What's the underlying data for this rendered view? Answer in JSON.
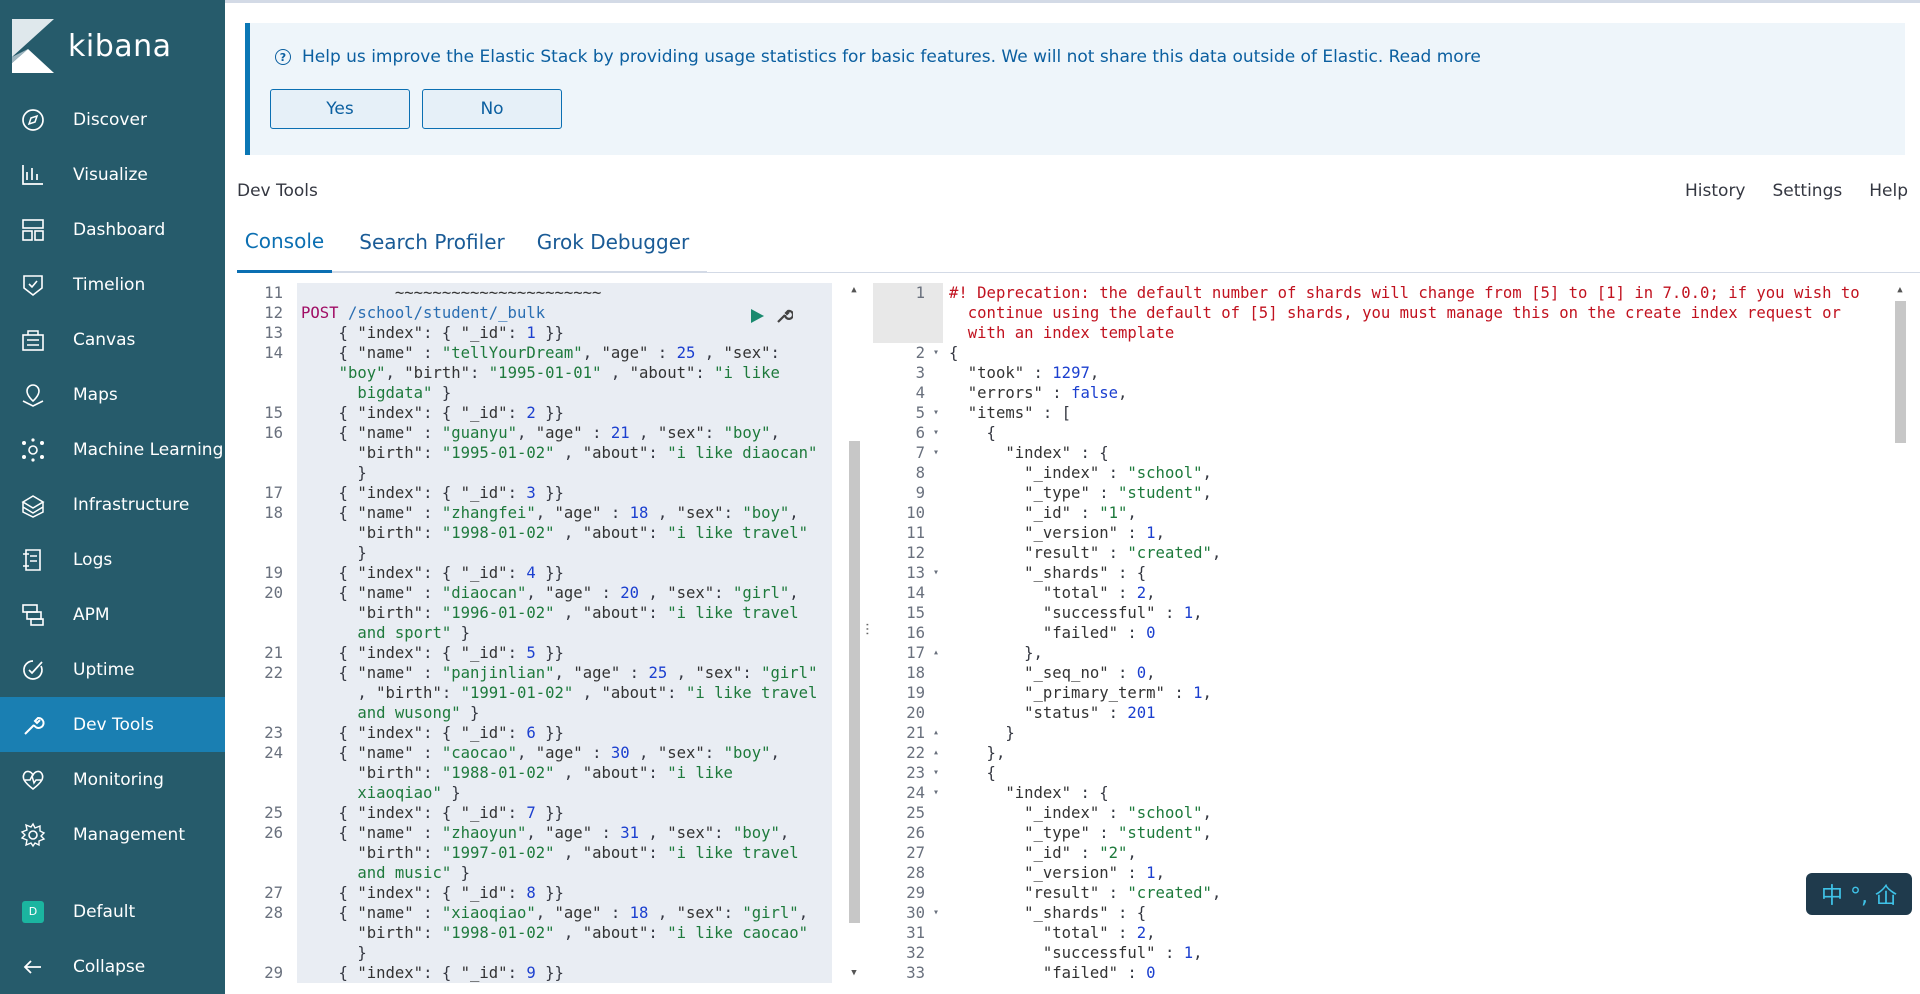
{
  "sidebar": {
    "logo_text": "kibana",
    "items": [
      {
        "label": "Discover",
        "icon": "compass-icon"
      },
      {
        "label": "Visualize",
        "icon": "visualize-icon"
      },
      {
        "label": "Dashboard",
        "icon": "dashboard-icon"
      },
      {
        "label": "Timelion",
        "icon": "timelion-icon"
      },
      {
        "label": "Canvas",
        "icon": "canvas-icon"
      },
      {
        "label": "Maps",
        "icon": "maps-icon"
      },
      {
        "label": "Machine Learning",
        "icon": "machine-learning-icon"
      },
      {
        "label": "Infrastructure",
        "icon": "infrastructure-icon"
      },
      {
        "label": "Logs",
        "icon": "logs-icon"
      },
      {
        "label": "APM",
        "icon": "apm-icon"
      },
      {
        "label": "Uptime",
        "icon": "uptime-icon"
      },
      {
        "label": "Dev Tools",
        "icon": "wrench-icon"
      },
      {
        "label": "Monitoring",
        "icon": "monitoring-icon"
      },
      {
        "label": "Management",
        "icon": "gear-icon"
      }
    ],
    "active": "Dev Tools",
    "space_badge": "D",
    "space_label": "Default",
    "collapse_label": "Collapse"
  },
  "callout": {
    "text": "Help us improve the Elastic Stack by providing usage statistics for basic features. We will not share this data outside of Elastic. Read more",
    "yes_label": "Yes",
    "no_label": "No"
  },
  "header": {
    "title": "Dev Tools",
    "links": [
      "History",
      "Settings",
      "Help"
    ]
  },
  "tabs": [
    "Console",
    "Search Profiler",
    "Grok Debugger"
  ],
  "request_editor": {
    "lines": [
      {
        "n": "11",
        "html": "<span class='plain'>          ~~~~~~~~~~~~~~~~~~~~~~</span>"
      },
      {
        "n": "12",
        "html": "<span class='k'>POST</span> <span class='url'>/school/student/_bulk</span>"
      },
      {
        "n": "13",
        "html": "    { <span class='key'>\"index\"</span>: { <span class='key'>\"_id\"</span>: <span class='num'>1</span> }}"
      },
      {
        "n": "14",
        "html": "    { <span class='key'>\"name\"</span> : <span class='str'>\"tellYourDream\"</span>, <span class='key'>\"age\"</span> : <span class='num'>25</span> , <span class='key'>\"sex\"</span>:"
      },
      {
        "n": "",
        "html": "    <span class='str'>\"boy\"</span>, <span class='key'>\"birth\"</span>: <span class='str'>\"1995-01-01\"</span> , <span class='key'>\"about\"</span>: <span class='str'>\"i like</span>"
      },
      {
        "n": "",
        "html": "      <span class='str'>bigdata\"</span> }"
      },
      {
        "n": "15",
        "html": "    { <span class='key'>\"index\"</span>: { <span class='key'>\"_id\"</span>: <span class='num'>2</span> }}"
      },
      {
        "n": "16",
        "html": "    { <span class='key'>\"name\"</span> : <span class='str'>\"guanyu\"</span>, <span class='key'>\"age\"</span> : <span class='num'>21</span> , <span class='key'>\"sex\"</span>: <span class='str'>\"boy\"</span>,"
      },
      {
        "n": "",
        "html": "      <span class='key'>\"birth\"</span>: <span class='str'>\"1995-01-02\"</span> , <span class='key'>\"about\"</span>: <span class='str'>\"i like diaocan\"</span>"
      },
      {
        "n": "",
        "html": "      }"
      },
      {
        "n": "17",
        "html": "    { <span class='key'>\"index\"</span>: { <span class='key'>\"_id\"</span>: <span class='num'>3</span> }}"
      },
      {
        "n": "18",
        "html": "    { <span class='key'>\"name\"</span> : <span class='str'>\"zhangfei\"</span>, <span class='key'>\"age\"</span> : <span class='num'>18</span> , <span class='key'>\"sex\"</span>: <span class='str'>\"boy\"</span>,"
      },
      {
        "n": "",
        "html": "      <span class='key'>\"birth\"</span>: <span class='str'>\"1998-01-02\"</span> , <span class='key'>\"about\"</span>: <span class='str'>\"i like travel\"</span>"
      },
      {
        "n": "",
        "html": "      }"
      },
      {
        "n": "19",
        "html": "    { <span class='key'>\"index\"</span>: { <span class='key'>\"_id\"</span>: <span class='num'>4</span> }}"
      },
      {
        "n": "20",
        "html": "    { <span class='key'>\"name\"</span> : <span class='str'>\"diaocan\"</span>, <span class='key'>\"age\"</span> : <span class='num'>20</span> , <span class='key'>\"sex\"</span>: <span class='str'>\"girl\"</span>,"
      },
      {
        "n": "",
        "html": "      <span class='key'>\"birth\"</span>: <span class='str'>\"1996-01-02\"</span> , <span class='key'>\"about\"</span>: <span class='str'>\"i like travel</span>"
      },
      {
        "n": "",
        "html": "      <span class='str'>and sport\"</span> }"
      },
      {
        "n": "21",
        "html": "    { <span class='key'>\"index\"</span>: { <span class='key'>\"_id\"</span>: <span class='num'>5</span> }}"
      },
      {
        "n": "22",
        "html": "    { <span class='key'>\"name\"</span> : <span class='str'>\"panjinlian\"</span>, <span class='key'>\"age\"</span> : <span class='num'>25</span> , <span class='key'>\"sex\"</span>: <span class='str'>\"girl\"</span>"
      },
      {
        "n": "",
        "html": "      , <span class='key'>\"birth\"</span>: <span class='str'>\"1991-01-02\"</span> , <span class='key'>\"about\"</span>: <span class='str'>\"i like travel</span>"
      },
      {
        "n": "",
        "html": "      <span class='str'>and wusong\"</span> }"
      },
      {
        "n": "23",
        "html": "    { <span class='key'>\"index\"</span>: { <span class='key'>\"_id\"</span>: <span class='num'>6</span> }}"
      },
      {
        "n": "24",
        "html": "    { <span class='key'>\"name\"</span> : <span class='str'>\"caocao\"</span>, <span class='key'>\"age\"</span> : <span class='num'>30</span> , <span class='key'>\"sex\"</span>: <span class='str'>\"boy\"</span>,"
      },
      {
        "n": "",
        "html": "      <span class='key'>\"birth\"</span>: <span class='str'>\"1988-01-02\"</span> , <span class='key'>\"about\"</span>: <span class='str'>\"i like</span>"
      },
      {
        "n": "",
        "html": "      <span class='str'>xiaoqiao\"</span> }"
      },
      {
        "n": "25",
        "html": "    { <span class='key'>\"index\"</span>: { <span class='key'>\"_id\"</span>: <span class='num'>7</span> }}"
      },
      {
        "n": "26",
        "html": "    { <span class='key'>\"name\"</span> : <span class='str'>\"zhaoyun\"</span>, <span class='key'>\"age\"</span> : <span class='num'>31</span> , <span class='key'>\"sex\"</span>: <span class='str'>\"boy\"</span>,"
      },
      {
        "n": "",
        "html": "      <span class='key'>\"birth\"</span>: <span class='str'>\"1997-01-02\"</span> , <span class='key'>\"about\"</span>: <span class='str'>\"i like travel</span>"
      },
      {
        "n": "",
        "html": "      <span class='str'>and music\"</span> }"
      },
      {
        "n": "27",
        "html": "    { <span class='key'>\"index\"</span>: { <span class='key'>\"_id\"</span>: <span class='num'>8</span> }}"
      },
      {
        "n": "28",
        "html": "    { <span class='key'>\"name\"</span> : <span class='str'>\"xiaoqiao\"</span>, <span class='key'>\"age\"</span> : <span class='num'>18</span> , <span class='key'>\"sex\"</span>: <span class='str'>\"girl\"</span>,"
      },
      {
        "n": "",
        "html": "      <span class='key'>\"birth\"</span>: <span class='str'>\"1998-01-02\"</span> , <span class='key'>\"about\"</span>: <span class='str'>\"i like caocao\"</span>"
      },
      {
        "n": "",
        "html": "      }"
      },
      {
        "n": "29",
        "html": "    { <span class='key'>\"index\"</span>: { <span class='key'>\"_id\"</span>: <span class='num'>9</span> }}"
      }
    ]
  },
  "response_editor": {
    "lines": [
      {
        "n": "1",
        "fold": "",
        "html": "<span class='warn'>#! Deprecation: the default number of shards will change from [5] to [1] in 7.0.0; if you wish to</span>"
      },
      {
        "n": "",
        "fold": "",
        "html": "<span class='warn'>  continue using the default of [5] shards, you must manage this on the create index request or</span>"
      },
      {
        "n": "",
        "fold": "",
        "html": "<span class='warn'>  with an index template</span>"
      },
      {
        "n": "2",
        "fold": "▾",
        "html": "{"
      },
      {
        "n": "3",
        "fold": "",
        "html": "  <span class='key'>\"took\"</span> : <span class='num'>1297</span>,"
      },
      {
        "n": "4",
        "fold": "",
        "html": "  <span class='key'>\"errors\"</span> : <span class='bool'>false</span>,"
      },
      {
        "n": "5",
        "fold": "▾",
        "html": "  <span class='key'>\"items\"</span> : ["
      },
      {
        "n": "6",
        "fold": "▾",
        "html": "    {"
      },
      {
        "n": "7",
        "fold": "▾",
        "html": "      <span class='key'>\"index\"</span> : {"
      },
      {
        "n": "8",
        "fold": "",
        "html": "        <span class='key'>\"_index\"</span> : <span class='str'>\"school\"</span>,"
      },
      {
        "n": "9",
        "fold": "",
        "html": "        <span class='key'>\"_type\"</span> : <span class='str'>\"student\"</span>,"
      },
      {
        "n": "10",
        "fold": "",
        "html": "        <span class='key'>\"_id\"</span> : <span class='str'>\"1\"</span>,"
      },
      {
        "n": "11",
        "fold": "",
        "html": "        <span class='key'>\"_version\"</span> : <span class='num'>1</span>,"
      },
      {
        "n": "12",
        "fold": "",
        "html": "        <span class='key'>\"result\"</span> : <span class='str'>\"created\"</span>,"
      },
      {
        "n": "13",
        "fold": "▾",
        "html": "        <span class='key'>\"_shards\"</span> : {"
      },
      {
        "n": "14",
        "fold": "",
        "html": "          <span class='key'>\"total\"</span> : <span class='num'>2</span>,"
      },
      {
        "n": "15",
        "fold": "",
        "html": "          <span class='key'>\"successful\"</span> : <span class='num'>1</span>,"
      },
      {
        "n": "16",
        "fold": "",
        "html": "          <span class='key'>\"failed\"</span> : <span class='num'>0</span>"
      },
      {
        "n": "17",
        "fold": "▴",
        "html": "        },"
      },
      {
        "n": "18",
        "fold": "",
        "html": "        <span class='key'>\"_seq_no\"</span> : <span class='num'>0</span>,"
      },
      {
        "n": "19",
        "fold": "",
        "html": "        <span class='key'>\"_primary_term\"</span> : <span class='num'>1</span>,"
      },
      {
        "n": "20",
        "fold": "",
        "html": "        <span class='key'>\"status\"</span> : <span class='num'>201</span>"
      },
      {
        "n": "21",
        "fold": "▴",
        "html": "      }"
      },
      {
        "n": "22",
        "fold": "▴",
        "html": "    },"
      },
      {
        "n": "23",
        "fold": "▾",
        "html": "    {"
      },
      {
        "n": "24",
        "fold": "▾",
        "html": "      <span class='key'>\"index\"</span> : {"
      },
      {
        "n": "25",
        "fold": "",
        "html": "        <span class='key'>\"_index\"</span> : <span class='str'>\"school\"</span>,"
      },
      {
        "n": "26",
        "fold": "",
        "html": "        <span class='key'>\"_type\"</span> : <span class='str'>\"student\"</span>,"
      },
      {
        "n": "27",
        "fold": "",
        "html": "        <span class='key'>\"_id\"</span> : <span class='str'>\"2\"</span>,"
      },
      {
        "n": "28",
        "fold": "",
        "html": "        <span class='key'>\"_version\"</span> : <span class='num'>1</span>,"
      },
      {
        "n": "29",
        "fold": "",
        "html": "        <span class='key'>\"result\"</span> : <span class='str'>\"created\"</span>,"
      },
      {
        "n": "30",
        "fold": "▾",
        "html": "        <span class='key'>\"_shards\"</span> : {"
      },
      {
        "n": "31",
        "fold": "",
        "html": "          <span class='key'>\"total\"</span> : <span class='num'>2</span>,"
      },
      {
        "n": "32",
        "fold": "",
        "html": "          <span class='key'>\"successful\"</span> : <span class='num'>1</span>,"
      },
      {
        "n": "33",
        "fold": "",
        "html": "          <span class='key'>\"failed\"</span> : <span class='num'>0</span>"
      }
    ]
  },
  "ime": {
    "label": "中 °, 仚"
  },
  "colors": {
    "sidebar": "#265b6b",
    "active_nav": "#1a7fb2",
    "accent": "#0b6fb2",
    "warning": "#c1121f"
  }
}
